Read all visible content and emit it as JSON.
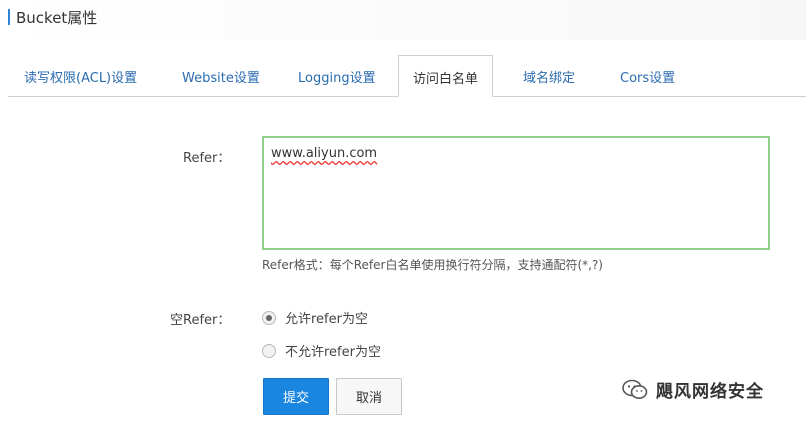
{
  "window": {
    "title": "Bucket属性"
  },
  "tabs": [
    {
      "label": "读写权限(ACL)设置"
    },
    {
      "label": "Website设置"
    },
    {
      "label": "Logging设置"
    },
    {
      "label": "访问白名单",
      "active": true
    },
    {
      "label": "域名绑定"
    },
    {
      "label": "Cors设置"
    }
  ],
  "form": {
    "refer_label": "Refer：",
    "refer_value": "www.aliyun.com",
    "refer_hint": "Refer格式：每个Refer白名单使用换行符分隔，支持通配符(*,?)",
    "empty_refer_label": "空Refer：",
    "radio_options": [
      {
        "label": "允许refer为空",
        "checked": true
      },
      {
        "label": "不允许refer为空",
        "checked": false
      }
    ],
    "submit_label": "提交",
    "cancel_label": "取消"
  },
  "watermark": {
    "text": "飓风网络安全"
  },
  "colors": {
    "accent": "#2a86d8",
    "primary_button": "#1b86e0",
    "focus_border": "#8fd18a",
    "tab_link": "#2b6cb0"
  }
}
